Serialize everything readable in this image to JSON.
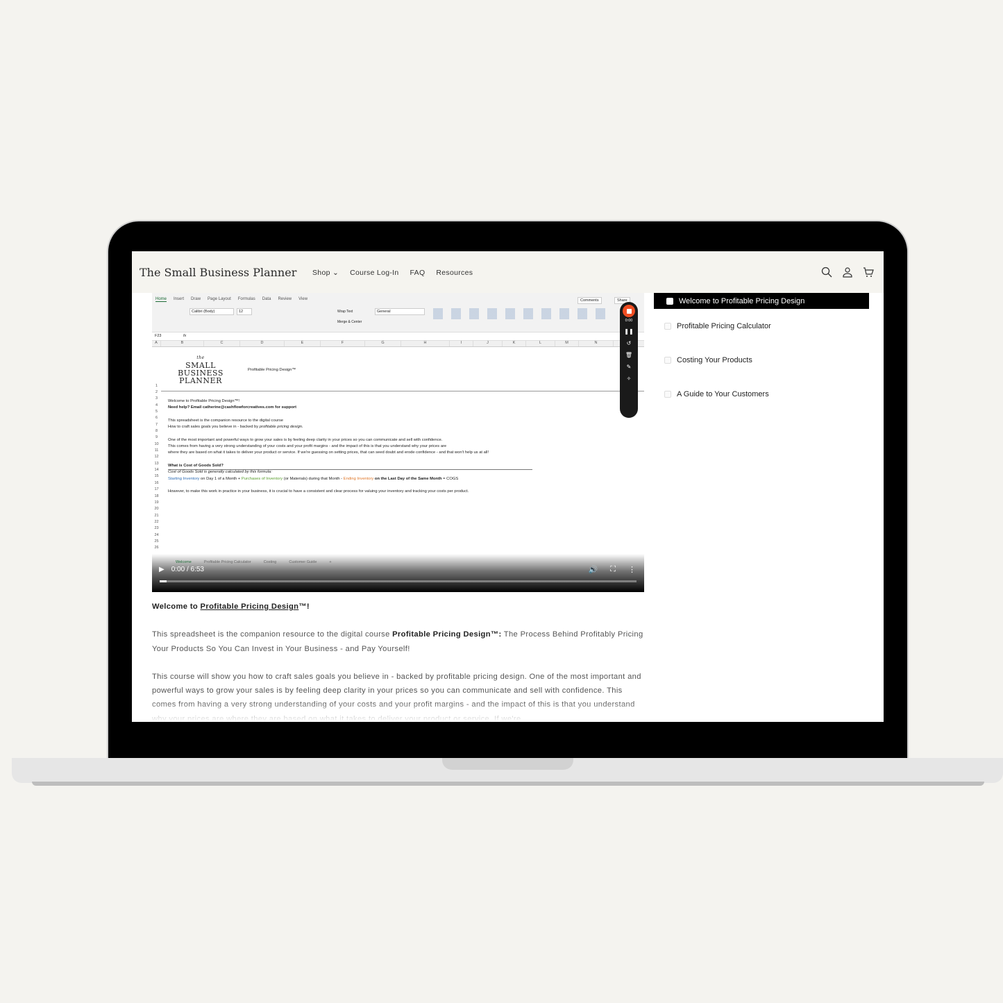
{
  "header": {
    "logo": "The Small Business Planner",
    "nav": [
      {
        "label": "Shop",
        "has_dropdown": true
      },
      {
        "label": "Course Log-In"
      },
      {
        "label": "FAQ"
      },
      {
        "label": "Resources"
      }
    ],
    "icons": [
      "search-icon",
      "account-icon",
      "cart-icon"
    ]
  },
  "video": {
    "time": "0:00 / 6:53",
    "progress": 0.0,
    "excel": {
      "tabs": [
        "Home",
        "Insert",
        "Draw",
        "Page Layout",
        "Formulas",
        "Data",
        "Review",
        "View"
      ],
      "comments": "Comments",
      "share": "Share",
      "font": "Calibri (Body)",
      "size": "12",
      "number_format": "General",
      "wrap_text": "Wrap Text",
      "merge": "Merge & Center",
      "cell_ref": "F23",
      "columns": [
        "A",
        "B",
        "C",
        "D",
        "E",
        "F",
        "G",
        "H",
        "I",
        "J",
        "K",
        "L",
        "M",
        "N"
      ],
      "logo_the": "the",
      "logo_lines": [
        "SMALL",
        "BUSINESS",
        "PLANNER"
      ],
      "title_cell": "Profitable Pricing Design™",
      "rows": [
        "1",
        "2",
        "3",
        "4",
        "5",
        "6",
        "7",
        "8",
        "9",
        "10",
        "11",
        "12",
        "13",
        "14",
        "15",
        "16",
        "17",
        "18",
        "19",
        "20",
        "21",
        "22",
        "23",
        "24",
        "25",
        "26"
      ],
      "lines": {
        "r3": "Welcome to Profitable Pricing Design™!",
        "r4": "Need help? Email catherine@cashflowforcreatives.com for support",
        "r6": "This spreadsheet is the companion resource to the digital course",
        "r7a": "How to craft sales goals you believe in - backed by ",
        "r7b": "profitable pricing design.",
        "r9": "One of the most important and powerful ways to grow your sales is by feeling deep clarity in your prices so you can communicate and sell with confidence.",
        "r10": "This comes from having a very strong understanding of your costs and your profit margins - and the impact of this is that you understand why your prices are",
        "r11": "where they are based on what it takes to deliver your product or service. If we're guessing on setting prices, that can seed doubt and erode confidence - and that won't help us at all!",
        "r13": "What is Cost of Goods Sold?",
        "r14": "Cost of Goods Sold is generally calculated by this formula:",
        "r15": {
          "a": "Starting Inventory",
          "b": " on Day 1 of a Month + ",
          "c": "Purchases of Inventory",
          "d": " (or Materials) during that Month - ",
          "e": "Ending Inventory",
          "f": " on the Last Day of the Same Month",
          "g": " = COGS"
        },
        "r17": "However, to make this work in practice in your business, it is crucial to have a consistent and clear process for valuing your inventory and tracking your costs per product."
      },
      "sheet_tabs": [
        "Welcome",
        "Profitable Pricing Calculator",
        "Costing",
        "Customer Guide",
        "+"
      ]
    },
    "recorder": {
      "time": "0:00",
      "record_color": "#f04e23"
    }
  },
  "colors": {
    "blue": "#2f6db5",
    "green": "#5a9e2f",
    "orange": "#e0782a",
    "header_bg": "#f5f4ef"
  },
  "sidebar": {
    "current": "Welcome to Profitable Pricing Design",
    "items": [
      {
        "label": "Profitable Pricing Calculator",
        "checked": false
      },
      {
        "label": "Costing Your Products",
        "checked": false
      },
      {
        "label": "A Guide to Your Customers",
        "checked": false
      }
    ]
  },
  "content": {
    "heading_pre": "Welcome to ",
    "heading_link": "Profitable Pricing Design",
    "heading_post": "™!",
    "p1_pre": "This spreadsheet is the companion resource to the digital course ",
    "p1_bold": "Profitable Pricing Design™:",
    "p1_post": " The Process Behind Profitably Pricing Your Products So You Can Invest in Your Business - and Pay Yourself!",
    "p2": "This course will show you how to craft sales goals you believe in - backed by profitable pricing design. One of the most important and powerful ways to grow your sales is by feeling deep clarity in your prices so you can communicate and sell with confidence. This comes from having a very strong understanding of your costs and your profit margins - and the impact of this is that you understand why your prices are where they are based on what it takes to deliver your product or service. If we're"
  }
}
